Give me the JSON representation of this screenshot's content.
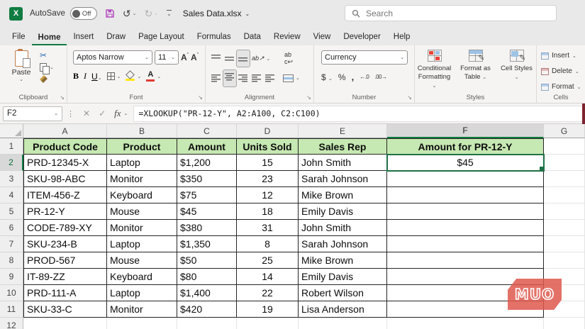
{
  "titlebar": {
    "autosave_label": "AutoSave",
    "autosave_state": "Off",
    "doc_title": "Sales Data.xlsx",
    "search_placeholder": "Search"
  },
  "menu": {
    "tabs": [
      "File",
      "Home",
      "Insert",
      "Draw",
      "Page Layout",
      "Formulas",
      "Data",
      "Review",
      "View",
      "Developer",
      "Help"
    ],
    "active_tab": "Home"
  },
  "ribbon": {
    "clipboard": {
      "label": "Clipboard",
      "paste_label": "Paste"
    },
    "font": {
      "label": "Font",
      "font_name": "Aptos Narrow",
      "font_size": "11",
      "bold": "B",
      "italic": "I",
      "underline": "U"
    },
    "alignment": {
      "label": "Alignment",
      "orientation": "ab",
      "wrap": "ab"
    },
    "number": {
      "label": "Number",
      "format": "Currency",
      "currency": "$",
      "percent": "%",
      "comma": ",",
      "inc_decimal": "←.0",
      "dec_decimal": ".00→"
    },
    "styles": {
      "label": "Styles",
      "conditional": "Conditional Formatting",
      "format_table": "Format as Table",
      "cell_styles": "Cell Styles"
    },
    "cells": {
      "label": "Cells",
      "insert": "Insert",
      "delete": "Delete",
      "format": "Format"
    }
  },
  "formula_bar": {
    "name_box": "F2",
    "fx": "fx",
    "formula": "=XLOOKUP(\"PR-12-Y\", A2:A100, C2:C100)"
  },
  "grid": {
    "column_letters": [
      "A",
      "B",
      "C",
      "D",
      "E",
      "F",
      "G"
    ],
    "selected_column": "F",
    "selected_cell": "F2",
    "headers": [
      "Product Code",
      "Product",
      "Amount",
      "Units Sold",
      "Sales Rep",
      "Amount for PR-12-Y"
    ],
    "rows": [
      {
        "n": 2,
        "cells": [
          "PRD-12345-X",
          "Laptop",
          "$1,200",
          "15",
          "John Smith",
          "$45"
        ]
      },
      {
        "n": 3,
        "cells": [
          "SKU-98-ABC",
          "Monitor",
          "$350",
          "23",
          "Sarah Johnson",
          ""
        ]
      },
      {
        "n": 4,
        "cells": [
          "ITEM-456-Z",
          "Keyboard",
          "$75",
          "12",
          "Mike Brown",
          ""
        ]
      },
      {
        "n": 5,
        "cells": [
          "PR-12-Y",
          "Mouse",
          "$45",
          "18",
          "Emily Davis",
          ""
        ]
      },
      {
        "n": 6,
        "cells": [
          "CODE-789-XY",
          "Monitor",
          "$380",
          "31",
          "John Smith",
          ""
        ]
      },
      {
        "n": 7,
        "cells": [
          "SKU-234-B",
          "Laptop",
          "$1,350",
          "8",
          "Sarah Johnson",
          ""
        ]
      },
      {
        "n": 8,
        "cells": [
          "PROD-567",
          "Mouse",
          "$50",
          "25",
          "Mike Brown",
          ""
        ]
      },
      {
        "n": 9,
        "cells": [
          "IT-89-ZZ",
          "Keyboard",
          "$80",
          "14",
          "Emily Davis",
          ""
        ]
      },
      {
        "n": 10,
        "cells": [
          "PRD-111-A",
          "Laptop",
          "$1,400",
          "22",
          "Robert Wilson",
          ""
        ]
      },
      {
        "n": 11,
        "cells": [
          "SKU-33-C",
          "Monitor",
          "$420",
          "19",
          "Lisa Anderson",
          ""
        ]
      },
      {
        "n": 12,
        "cells": [
          "",
          "",
          "",
          "",
          "",
          ""
        ]
      }
    ]
  },
  "watermark": "MUO",
  "colors": {
    "accent_green": "#107C41",
    "selection_green": "#1E7145",
    "header_fill": "#C6E8B2",
    "watermark_red": "#DF584D",
    "save_icon_purple": "#B44FC0"
  }
}
